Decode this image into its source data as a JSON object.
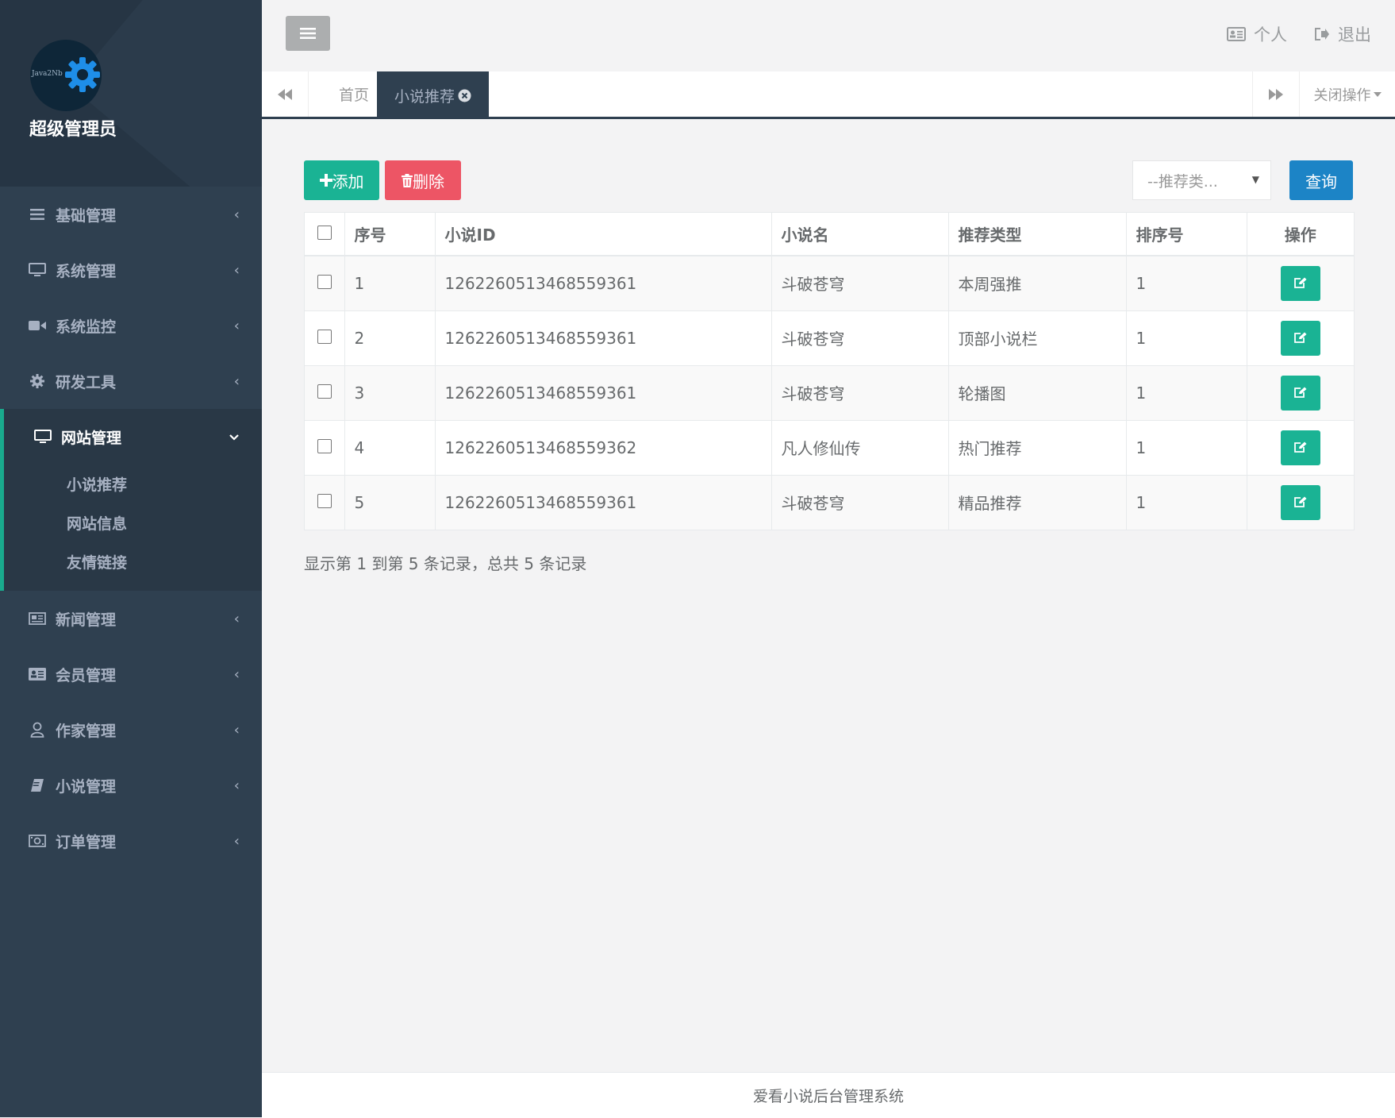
{
  "sidebar": {
    "logo_text": "Java2Nb",
    "admin_name": "超级管理员",
    "menu": [
      {
        "label": "基础管理",
        "icon": "bars-icon"
      },
      {
        "label": "系统管理",
        "icon": "desktop-icon"
      },
      {
        "label": "系统监控",
        "icon": "video-camera-icon"
      },
      {
        "label": "研发工具",
        "icon": "gear-icon"
      },
      {
        "label": "网站管理",
        "icon": "desktop-icon",
        "expanded": true,
        "children": [
          "小说推荐",
          "网站信息",
          "友情链接"
        ]
      },
      {
        "label": "新闻管理",
        "icon": "newspaper-icon"
      },
      {
        "label": "会员管理",
        "icon": "id-card-icon"
      },
      {
        "label": "作家管理",
        "icon": "user-icon"
      },
      {
        "label": "小说管理",
        "icon": "book-icon"
      },
      {
        "label": "订单管理",
        "icon": "money-icon"
      }
    ]
  },
  "topbar": {
    "profile_label": "个人",
    "logout_label": "退出"
  },
  "tabs": {
    "home_label": "首页",
    "current_label": "小说推荐",
    "close_ops_label": "关闭操作"
  },
  "toolbar": {
    "add_label": "添加",
    "delete_label": "删除",
    "type_select_placeholder": "--推荐类...",
    "search_label": "查询"
  },
  "table": {
    "headers": [
      "序号",
      "小说ID",
      "小说名",
      "推荐类型",
      "排序号",
      "操作"
    ],
    "rows": [
      {
        "index": "1",
        "novel_id": "1262260513468559361",
        "name": "斗破苍穹",
        "type": "本周强推",
        "sort": "1"
      },
      {
        "index": "2",
        "novel_id": "1262260513468559361",
        "name": "斗破苍穹",
        "type": "顶部小说栏",
        "sort": "1"
      },
      {
        "index": "3",
        "novel_id": "1262260513468559361",
        "name": "斗破苍穹",
        "type": "轮播图",
        "sort": "1"
      },
      {
        "index": "4",
        "novel_id": "1262260513468559362",
        "name": "凡人修仙传",
        "type": "热门推荐",
        "sort": "1"
      },
      {
        "index": "5",
        "novel_id": "1262260513468559361",
        "name": "斗破苍穹",
        "type": "精品推荐",
        "sort": "1"
      }
    ]
  },
  "pagination_info": "显示第 1 到第 5 条记录，总共 5 条记录",
  "footer": "爱看小说后台管理系统",
  "colors": {
    "sidebar_bg": "#2f4050",
    "accent_green": "#1ab394",
    "danger_red": "#ed5565",
    "primary_blue": "#1c84c6"
  }
}
